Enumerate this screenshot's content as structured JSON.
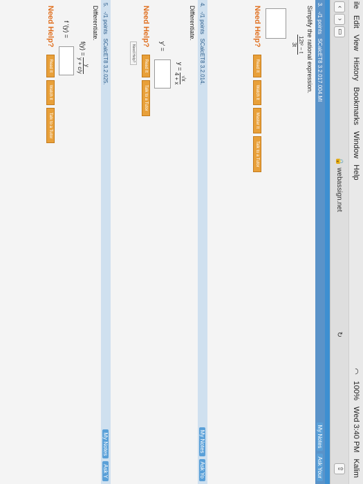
{
  "menubar": {
    "items": [
      "ile",
      "Edit",
      "View",
      "History",
      "Bookmarks",
      "Window",
      "Help"
    ],
    "battery": "100%",
    "clock": "Wed 3:40 PM",
    "user": "Kalim"
  },
  "address": "webassign.net",
  "questions": [
    {
      "num": "3.",
      "points": "-/1 points",
      "code": "SCalcET8 3.2.017.004.MI",
      "prompt": "Simplify the rational expression.",
      "expr_num": "12t² − t",
      "expr_den": "3t",
      "help_label": "Need Help?",
      "buttons": [
        "Read It",
        "Watch It",
        "Master It",
        "Talk to a Tutor"
      ],
      "notes": "My Notes",
      "ask": "Ask Your"
    },
    {
      "num": "4.",
      "points": "-/1 points",
      "code": "SCalcET8 3.2.014.",
      "prompt": "Differentiate.",
      "eq_lhs": "y =",
      "eq_num": "√x",
      "eq_den": "4 + x",
      "answer_lhs": "y' =",
      "help_label": "Need Help?",
      "buttons": [
        "Read It",
        "Talk to a Tutor"
      ],
      "small_label": "Need Help?",
      "notes": "My Notes",
      "ask": "Ask Yo"
    },
    {
      "num": "5.",
      "points": "-/1 points",
      "code": "SCalcET8 3.2.025.",
      "prompt": "Differentiate.",
      "eq_lhs": "f(y) =",
      "eq_num": "y",
      "eq_den": "y + c/y",
      "answer_lhs": "f '(y) =",
      "help_label": "Need Help?",
      "buttons": [
        "Read It",
        "Watch It",
        "Talk to a Tutor"
      ],
      "notes": "My Notes",
      "ask": "Ask Y"
    }
  ]
}
